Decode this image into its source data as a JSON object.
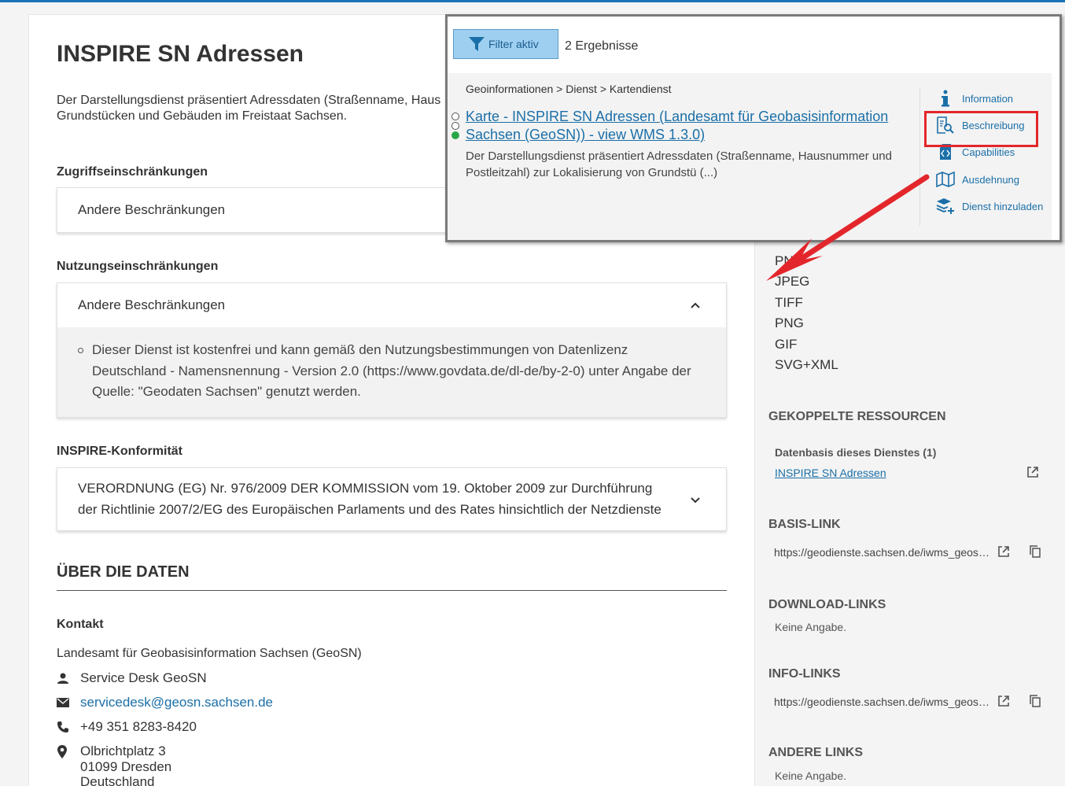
{
  "page": {
    "title": "INSPIRE SN Adressen",
    "description": "Der Darstellungsdienst präsentiert Adressdaten (Straßenname, Haus",
    "description_line2": "Grundstücken und Gebäuden im Freistaat Sachsen."
  },
  "access": {
    "label": "Zugriffseinschränkungen",
    "value": "Andere Beschränkungen"
  },
  "usage": {
    "label": "Nutzungseinschränkungen",
    "value": "Andere Beschränkungen",
    "detail_line1": "Dieser Dienst ist kostenfrei und kann gemäß den Nutzungsbestimmungen von Datenlizenz",
    "detail_line2": "Deutschland - Namensnennung - Version 2.0 (https://www.govdata.de/dl-de/by-2-0) unter Angabe der",
    "detail_line3": "Quelle: \"Geodaten Sachsen\" genutzt werden."
  },
  "inspire": {
    "label": "INSPIRE-Konformität",
    "line1": "VERORDNUNG (EG) Nr. 976/2009 DER KOMMISSION vom 19. Oktober 2009 zur Durchführung",
    "line2": "der Richtlinie 2007/2/EG des Europäischen Parlaments und des Rates hinsichtlich der Netzdienste"
  },
  "about": {
    "title": "ÜBER DIE DATEN",
    "contact_label": "Kontakt",
    "org": "Landesamt für Geobasisinformation Sachsen (GeoSN)",
    "person": "Service Desk GeoSN",
    "email": "servicedesk@geosn.sachsen.de",
    "phone": "+49 351 8283-8420",
    "street": "Olbrichtplatz 3",
    "city": "01099  Dresden",
    "country": "Deutschland"
  },
  "sidebar": {
    "formats": [
      "PNG",
      "JPEG",
      "TIFF",
      "PNG",
      "GIF",
      "SVG+XML"
    ],
    "coupled_title": "GEKOPPELTE RESSOURCEN",
    "coupled_sub": "Datenbasis dieses Dienstes (1)",
    "coupled_link": "INSPIRE SN Adressen",
    "basis_title": "BASIS-LINK",
    "basis_url": "https://geodienste.sachsen.de/iwms_geosn_inspire-adressen/guest",
    "download_title": "DOWNLOAD-LINKS",
    "download_value": "Keine Angabe.",
    "info_title": "INFO-LINKS",
    "info_url": "https://geodienste.sachsen.de/iwms_geosn_inspire-adressen/guest",
    "other_title": "ANDERE LINKS",
    "other_value": "Keine Angabe."
  },
  "popup": {
    "filter_label": "Filter aktiv",
    "results": "2 Ergebnisse",
    "breadcrumb": "Geoinformationen > Dienst > Kartendienst",
    "result_title_line1": "Karte - INSPIRE SN Adressen (Landesamt für Geobasisinformation",
    "result_title_line2": "Sachsen (GeoSN)) - view WMS 1.3.0)",
    "result_desc_line1": "Der Darstellungsdienst präsentiert Adressdaten (Straßenname, Hausnummer und",
    "result_desc_line2": "Postleitzahl) zur Lokalisierung von Grundstü (...)",
    "actions": {
      "information": "Information",
      "beschreibung": "Beschreibung",
      "capabilities": "Capabilities",
      "ausdehnung": "Ausdehnung",
      "dienst": "Dienst hinzuladen"
    }
  },
  "colors": {
    "link": "#1b6fa8",
    "highlight": "#e3262b",
    "status_active": "#2aa745"
  }
}
